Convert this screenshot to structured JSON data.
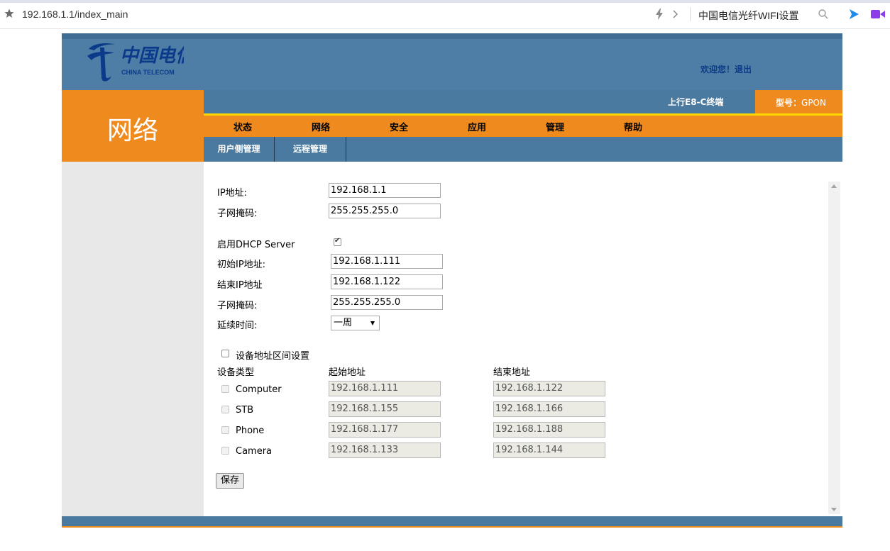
{
  "browser": {
    "url": "192.168.1.1/index_main",
    "search_text": "中国电信光纤WIFI设置"
  },
  "header": {
    "welcome": "欢迎您！",
    "logout": "退出"
  },
  "section_title": "网络",
  "infobar": {
    "device": "上行E8-C终端",
    "model_label": "型号：",
    "model_value": "GPON"
  },
  "nav": [
    "状态",
    "网络",
    "安全",
    "应用",
    "管理",
    "帮助"
  ],
  "subnav": [
    "用户侧管理",
    "远程管理"
  ],
  "form": {
    "ip_label": "IP地址:",
    "ip_value": "192.168.1.1",
    "mask_label": "子网掩码:",
    "mask_value": "255.255.255.0",
    "dhcp_label": "启用DHCP Server",
    "dhcp_checked": true,
    "start_ip_label": "初始IP地址:",
    "start_ip_value": "192.168.1.111",
    "end_ip_label": "结束IP地址",
    "end_ip_value": "192.168.1.122",
    "dhcp_mask_label": "子网掩码:",
    "dhcp_mask_value": "255.255.255.0",
    "lease_label": "延续时间:",
    "lease_value": "一周",
    "range_label": "设备地址区间设置",
    "range_checked": false,
    "col_type": "设备类型",
    "col_start": "起始地址",
    "col_end": "结束地址",
    "devices": [
      {
        "name": "Computer",
        "start": "192.168.1.111",
        "end": "192.168.1.122"
      },
      {
        "name": "STB",
        "start": "192.168.1.155",
        "end": "192.168.1.166"
      },
      {
        "name": "Phone",
        "start": "192.168.1.177",
        "end": "192.168.1.188"
      },
      {
        "name": "Camera",
        "start": "192.168.1.133",
        "end": "192.168.1.144"
      }
    ],
    "save": "保存"
  }
}
